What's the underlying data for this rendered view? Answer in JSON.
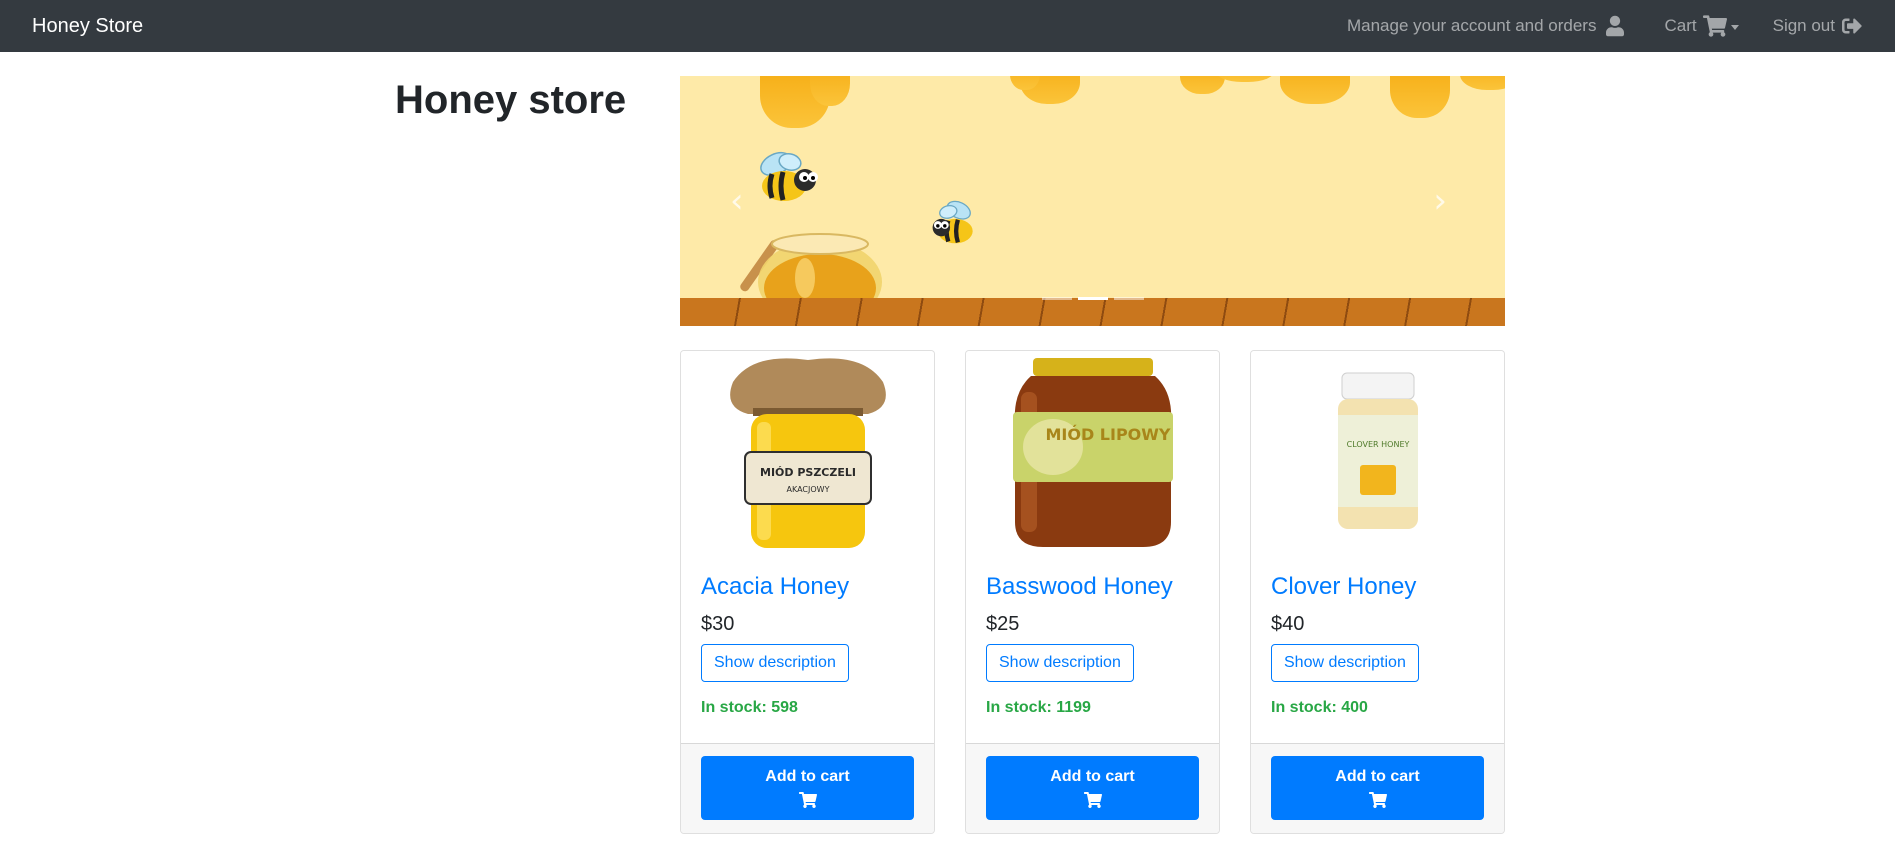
{
  "navbar": {
    "brand": "Honey Store",
    "account_label": "Manage your account and orders",
    "account_icon": "user-icon",
    "cart_label": "Cart",
    "cart_icon": "shopping-cart-icon",
    "signout_label": "Sign out",
    "signout_icon": "sign-out-icon"
  },
  "page": {
    "title": "Honey store"
  },
  "carousel": {
    "prev_icon": "chevron-left-icon",
    "next_icon": "chevron-right-icon",
    "slide_count": 3,
    "active_slide": 2
  },
  "products": [
    {
      "name": "Acacia Honey",
      "price": "$30",
      "description_button": "Show description",
      "stock": "In stock: 598",
      "add_label": "Add to cart"
    },
    {
      "name": "Basswood Honey",
      "price": "$25",
      "description_button": "Show description",
      "stock": "In stock: 1199",
      "add_label": "Add to cart"
    },
    {
      "name": "Clover Honey",
      "price": "$40",
      "description_button": "Show description",
      "stock": "In stock: 400",
      "add_label": "Add to cart"
    }
  ],
  "product_image_labels": {
    "acacia": "MIÓD PSZCZELI",
    "acacia_sub": "AKACJOWY",
    "basswood": "MIÓD LIPOWY",
    "clover": "CLOVER HONEY"
  },
  "colors": {
    "navbar": "#343a40",
    "primary": "#007bff",
    "success": "#28a745"
  }
}
